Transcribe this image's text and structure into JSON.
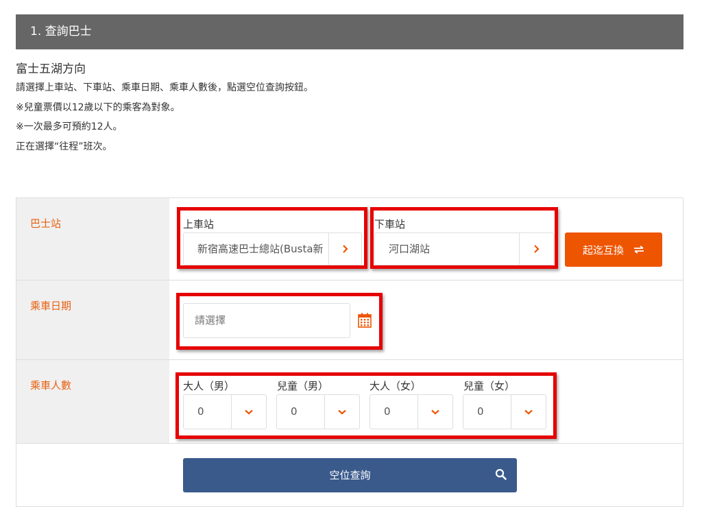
{
  "header": {
    "title": "1. 查詢巴士"
  },
  "intro": {
    "subtitle": "富士五湖方向",
    "lines": [
      "請選擇上車站、下車站、乘車日期、乘車人數後，點選空位查詢按鈕。",
      "※兒童票價以12歲以下的乘客為對象。",
      "※一次最多可預約12人。",
      "正在選擇“往程”班次。"
    ]
  },
  "form": {
    "bus_stop": {
      "label": "巴士站",
      "boarding": {
        "label": "上車站",
        "value": "新宿高速巴士總站(Busta新"
      },
      "alighting": {
        "label": "下車站",
        "value": "河口湖站"
      },
      "swap_label": "起迄互換"
    },
    "date": {
      "label": "乘車日期",
      "placeholder": "請選擇"
    },
    "passengers": {
      "label": "乘車人數",
      "fields": [
        {
          "label": "大人（男）",
          "value": "0"
        },
        {
          "label": "兒童（男）",
          "value": "0"
        },
        {
          "label": "大人（女）",
          "value": "0"
        },
        {
          "label": "兒童（女）",
          "value": "0"
        }
      ]
    },
    "search_label": "空位查詢"
  },
  "colors": {
    "accent": "#ee5500",
    "primary": "#3a5a8c",
    "highlight": "#e60000",
    "header_bg": "#666666"
  },
  "icons": [
    "chevron-right-icon",
    "swap-icon",
    "calendar-icon",
    "chevron-down-icon",
    "search-icon"
  ]
}
